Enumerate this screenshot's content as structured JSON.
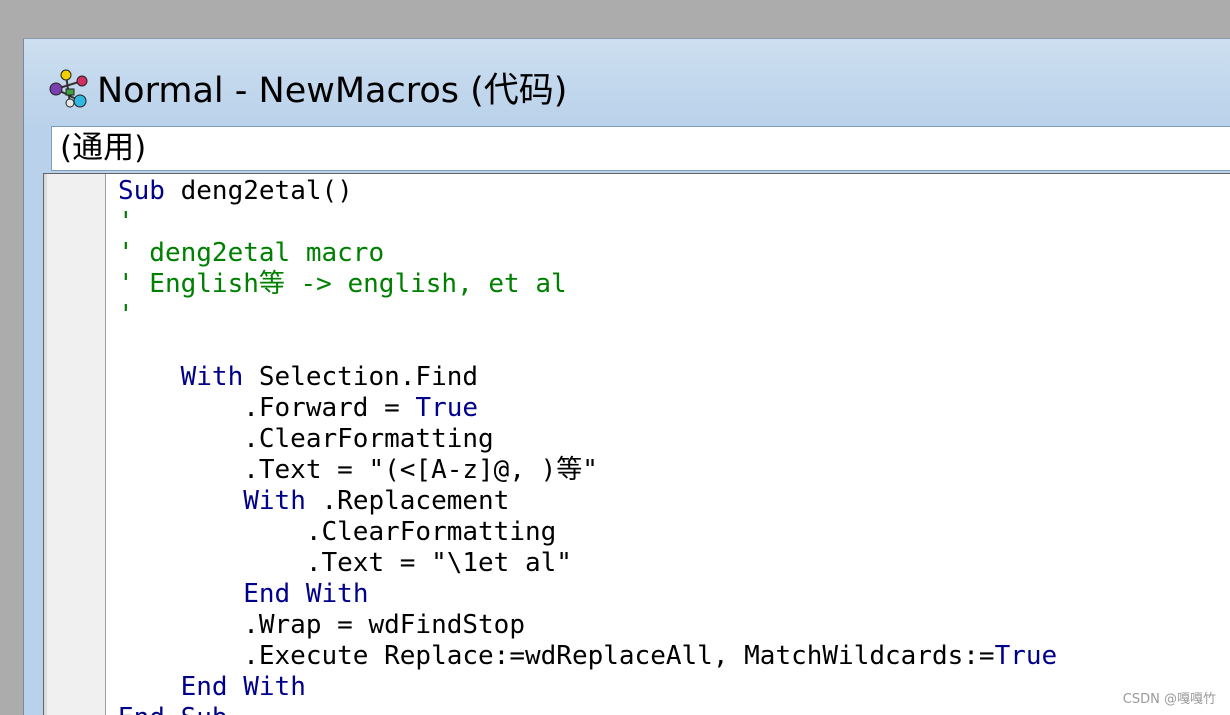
{
  "window": {
    "title": "Normal - NewMacros (代码)",
    "icon": "vba-macro-icon"
  },
  "object_dropdown": {
    "selected": "(通用)"
  },
  "code_lines": [
    [
      {
        "t": "Sub",
        "c": "kw"
      },
      {
        "t": " deng2etal()",
        "c": ""
      }
    ],
    [
      {
        "t": "'",
        "c": "cm"
      }
    ],
    [
      {
        "t": "' deng2etal macro",
        "c": "cm"
      }
    ],
    [
      {
        "t": "' English等 -> english, et al",
        "c": "cm"
      }
    ],
    [
      {
        "t": "'",
        "c": "cm"
      }
    ],
    [
      {
        "t": "",
        "c": ""
      }
    ],
    [
      {
        "t": "    ",
        "c": ""
      },
      {
        "t": "With",
        "c": "kw"
      },
      {
        "t": " Selection.Find",
        "c": ""
      }
    ],
    [
      {
        "t": "        .Forward = ",
        "c": ""
      },
      {
        "t": "True",
        "c": "kw"
      }
    ],
    [
      {
        "t": "        .ClearFormatting",
        "c": ""
      }
    ],
    [
      {
        "t": "        .Text = \"(<[A-z]@, )等\"",
        "c": ""
      }
    ],
    [
      {
        "t": "        ",
        "c": ""
      },
      {
        "t": "With",
        "c": "kw"
      },
      {
        "t": " .Replacement",
        "c": ""
      }
    ],
    [
      {
        "t": "            .ClearFormatting",
        "c": ""
      }
    ],
    [
      {
        "t": "            .Text = \"\\1et al\"",
        "c": ""
      }
    ],
    [
      {
        "t": "        ",
        "c": ""
      },
      {
        "t": "End",
        "c": "kw"
      },
      {
        "t": " ",
        "c": ""
      },
      {
        "t": "With",
        "c": "kw"
      }
    ],
    [
      {
        "t": "        .Wrap = wdFindStop",
        "c": ""
      }
    ],
    [
      {
        "t": "        .Execute Replace:=wdReplaceAll, MatchWildcards:=",
        "c": ""
      },
      {
        "t": "True",
        "c": "kw"
      }
    ],
    [
      {
        "t": "    ",
        "c": ""
      },
      {
        "t": "End",
        "c": "kw"
      },
      {
        "t": " ",
        "c": ""
      },
      {
        "t": "With",
        "c": "kw"
      }
    ],
    [
      {
        "t": "End",
        "c": "kw"
      },
      {
        "t": " ",
        "c": ""
      },
      {
        "t": "Sub",
        "c": "kw"
      }
    ]
  ],
  "watermark": "CSDN @嘎嘎竹",
  "colors": {
    "keyword": "#00008b",
    "comment": "#008000",
    "titlebar": "#b9d1ea"
  }
}
